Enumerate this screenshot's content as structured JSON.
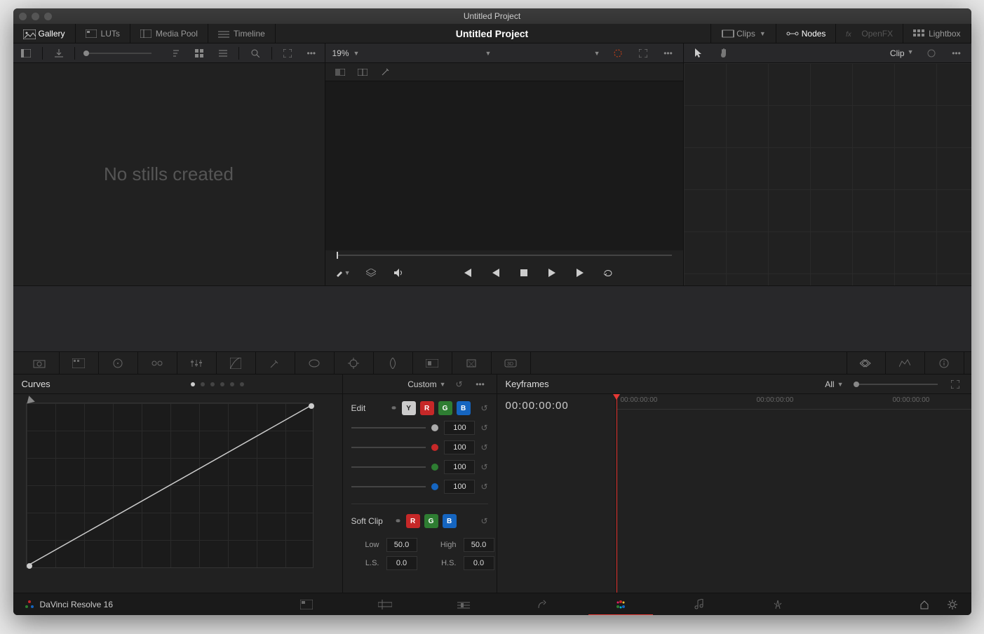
{
  "titlebar": {
    "title": "Untitled Project"
  },
  "toolbar": {
    "title": "Untitled Project",
    "left": {
      "gallery": "Gallery",
      "luts": "LUTs",
      "mediapool": "Media Pool",
      "timeline": "Timeline"
    },
    "right": {
      "clips": "Clips",
      "nodes": "Nodes",
      "openfx": "OpenFX",
      "lightbox": "Lightbox"
    }
  },
  "gallery": {
    "empty_text": "No stills created"
  },
  "viewer": {
    "zoom": "19%"
  },
  "nodes_panel": {
    "mode": "Clip"
  },
  "curves": {
    "title": "Curves",
    "mode": "Custom",
    "edit": {
      "label": "Edit",
      "channels": {
        "y": "Y",
        "r": "R",
        "g": "G",
        "b": "B"
      },
      "values": {
        "lum": "100",
        "r": "100",
        "g": "100",
        "b": "100"
      }
    },
    "softclip": {
      "label": "Soft Clip",
      "channels": {
        "r": "R",
        "g": "G",
        "b": "B"
      },
      "low_label": "Low",
      "low": "50.0",
      "high_label": "High",
      "high": "50.0",
      "ls_label": "L.S.",
      "ls": "0.0",
      "hs_label": "H.S.",
      "hs": "0.0"
    }
  },
  "keyframes": {
    "title": "Keyframes",
    "filter": "All",
    "timecode": "00:00:00:00",
    "ticks": [
      "00:00:00:00",
      "00:00:00:00",
      "00:00:00:00"
    ]
  },
  "bottombar": {
    "app": "DaVinci Resolve 16"
  },
  "colors": {
    "red": "#c62828",
    "green": "#2e7d32",
    "blue": "#1565c0",
    "playhead": "#e53935"
  }
}
